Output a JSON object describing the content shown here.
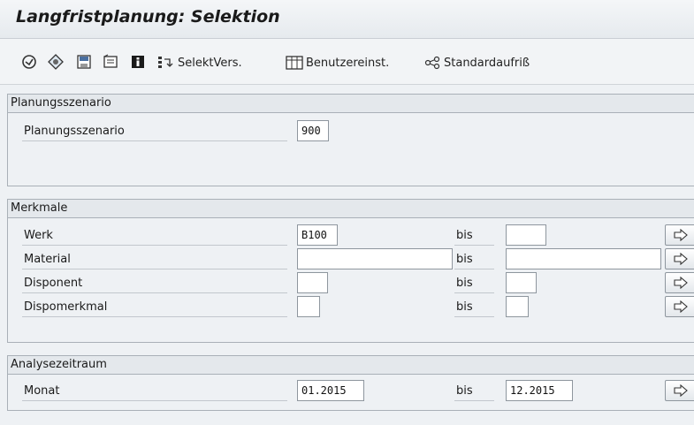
{
  "window": {
    "title": "Langfristplanung: Selektion"
  },
  "toolbar": {
    "icons": [
      "execute-icon",
      "execute-background-icon",
      "save-variant-icon",
      "selection-options-icon",
      "info-icon",
      "variant-icon"
    ],
    "selekt_vers_label": "SelektVers.",
    "benutzereinst_label": "Benutzereinst.",
    "standardaufriss_label": "Standardaufriß"
  },
  "groups": {
    "scenario": {
      "title": "Planungsszenario",
      "label": "Planungsszenario",
      "value": "900"
    },
    "merkmale": {
      "title": "Merkmale",
      "rows": [
        {
          "label": "Werk",
          "from": "B100",
          "bis": "bis",
          "to": ""
        },
        {
          "label": "Material",
          "from": "",
          "bis": "bis",
          "to": ""
        },
        {
          "label": "Disponent",
          "from": "",
          "bis": "bis",
          "to": ""
        },
        {
          "label": "Dispomerkmal",
          "from": "",
          "bis": "bis",
          "to": ""
        }
      ]
    },
    "zeitraum": {
      "title": "Analysezeitraum",
      "label": "Monat",
      "from": "01.2015",
      "bis": "bis",
      "to": "12.2015"
    }
  },
  "colors": {
    "background": "#eef1f4",
    "border": "#a9b0b7",
    "field": "#ffffff"
  }
}
